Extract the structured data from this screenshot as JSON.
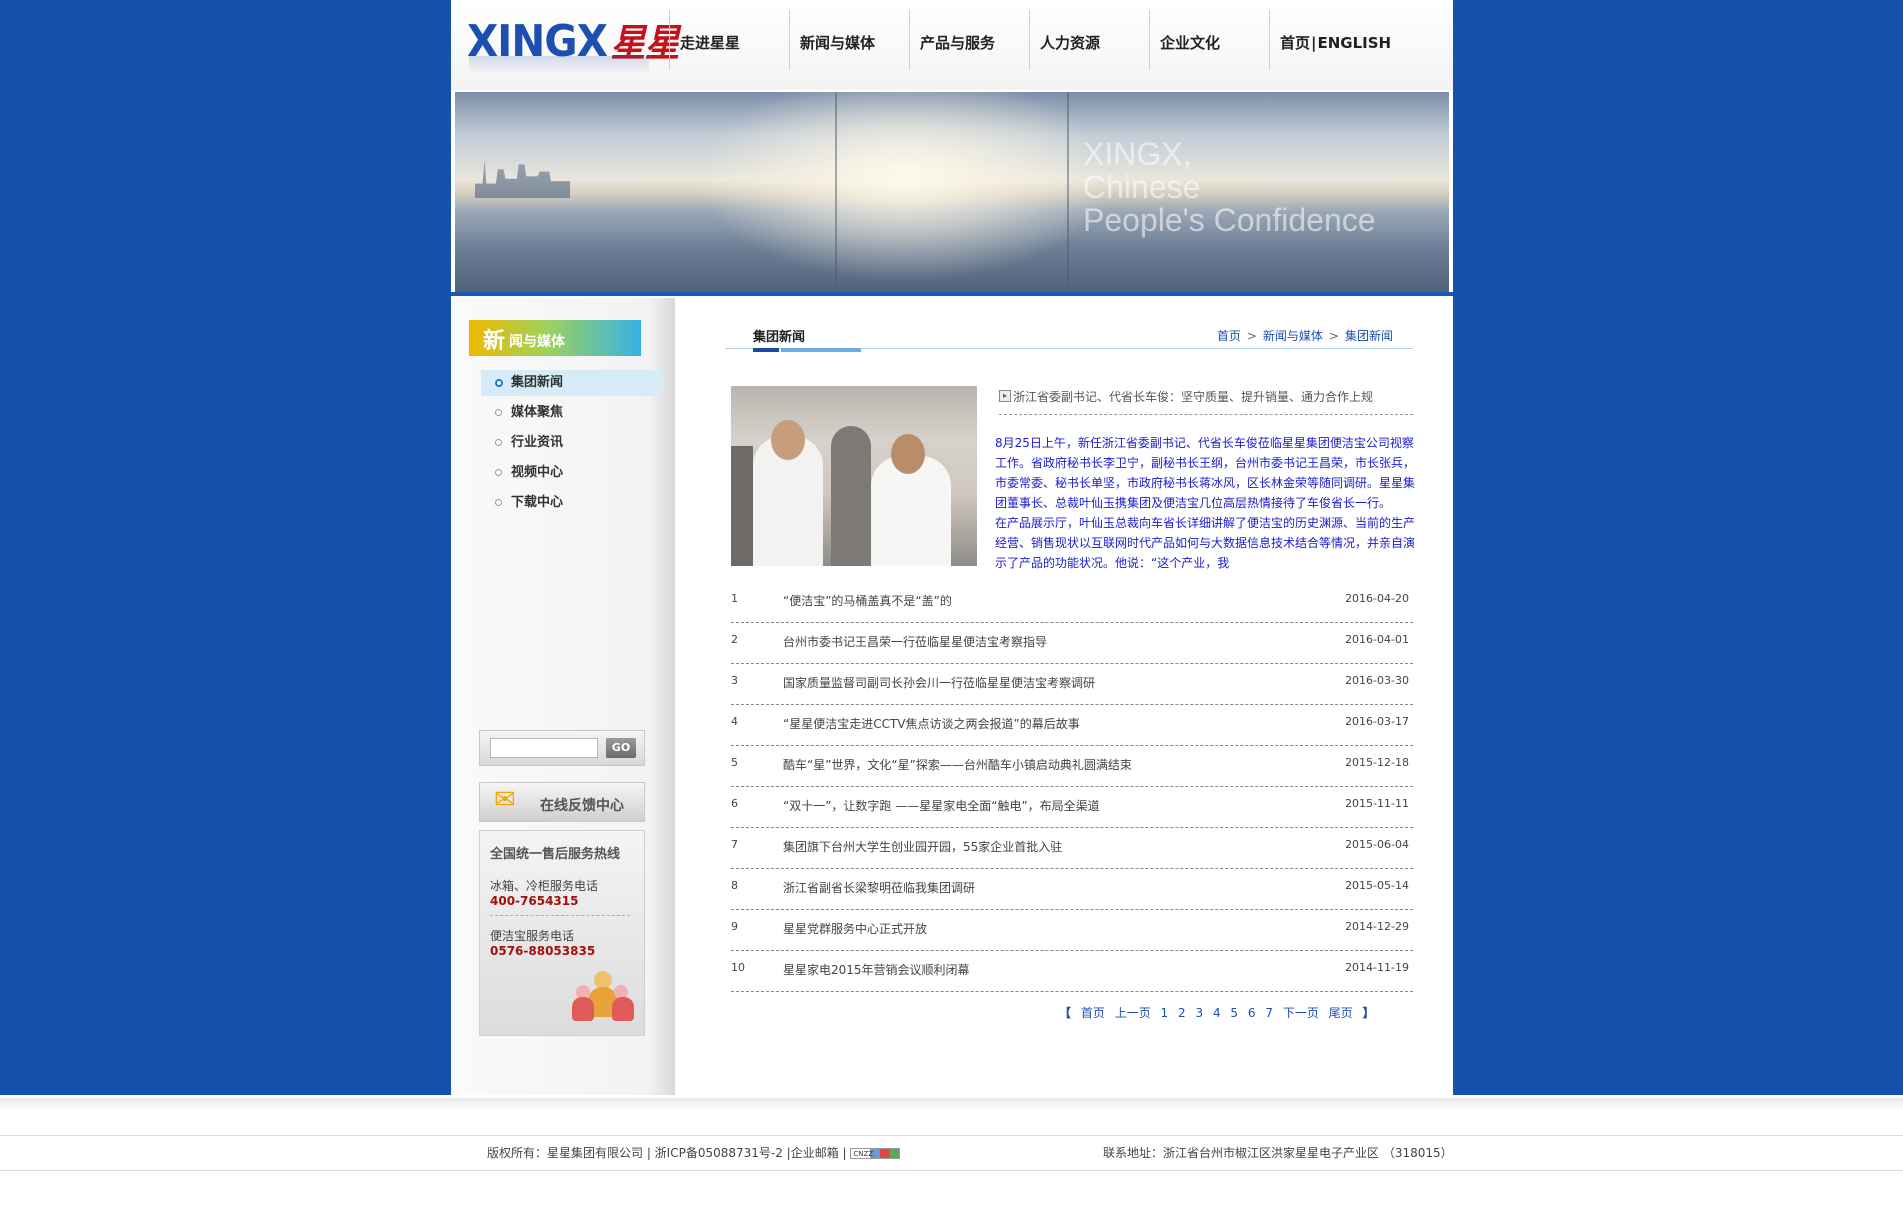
{
  "header": {
    "logo_text": "XINGX",
    "logo_cn": "星星",
    "nav": [
      "走进星星",
      "新闻与媒体",
      "产品与服务",
      "人力资源",
      "企业文化"
    ],
    "nav_home": "首页",
    "nav_english": "ENGLISH"
  },
  "banner": {
    "line1": "XINGX,",
    "line2": "Chinese",
    "line3": "People's Confidence"
  },
  "sidebar": {
    "title_big": "新",
    "title_rest": "闻与媒体",
    "menu": [
      "集团新闻",
      "媒体聚焦",
      "行业资讯",
      "视频中心",
      "下载中心"
    ],
    "search_placeholder": "",
    "search_button": "GO",
    "feedback_label": "在线反馈中心",
    "service_title": "全国统一售后服务热线",
    "service1_label": "冰箱、冷柜服务电话",
    "service1_phone": "400-7654315",
    "service2_label": "便洁宝服务电话",
    "service2_phone": "0576-88053835"
  },
  "content": {
    "section_title": "集团新闻",
    "breadcrumb": [
      "首页",
      "新闻与媒体",
      "集团新闻"
    ],
    "feature_title": "浙江省委副书记、代省长车俊：坚守质量、提升销量、通力合作上规",
    "feature_body": "8月25日上午，新任浙江省委副书记、代省长车俊莅临星星集团便洁宝公司视察工作。省政府秘书长李卫宁，副秘书长王纲，台州市委书记王昌荣，市长张兵，市委常委、秘书长单坚，市政府秘书长蒋冰风，区长林金荣等随同调研。星星集团董事长、总裁叶仙玉携集团及便洁宝几位高层热情接待了车俊省长一行。　　在产品展示厅，叶仙玉总裁向车省长详细讲解了便洁宝的历史渊源、当前的生产经营、销售现状以互联网时代产品如何与大数据信息技术结合等情况，并亲自演示了产品的功能状况。他说：“这个产业，我",
    "news": [
      {
        "num": "1",
        "title": "“便洁宝”的马桶盖真不是“盖”的",
        "date": "2016-04-20"
      },
      {
        "num": "2",
        "title": "台州市委书记王昌荣一行莅临星星便洁宝考察指导",
        "date": "2016-04-01"
      },
      {
        "num": "3",
        "title": "国家质量监督司副司长孙会川一行莅临星星便洁宝考察调研",
        "date": "2016-03-30"
      },
      {
        "num": "4",
        "title": "“星星便洁宝走进CCTV焦点访谈之两会报道”的幕后故事",
        "date": "2016-03-17"
      },
      {
        "num": "5",
        "title": "酷车“星”世界，文化“星”探索——台州酷车小镇启动典礼圆满结束",
        "date": "2015-12-18"
      },
      {
        "num": "6",
        "title": "“双十一”，让数字跑 ——星星家电全面“触电”，布局全渠道",
        "date": "2015-11-11"
      },
      {
        "num": "7",
        "title": "集团旗下台州大学生创业园开园，55家企业首批入驻",
        "date": "2015-06-04"
      },
      {
        "num": "8",
        "title": "浙江省副省长梁黎明莅临我集团调研",
        "date": "2015-05-14"
      },
      {
        "num": "9",
        "title": "星星党群服务中心正式开放",
        "date": "2014-12-29"
      },
      {
        "num": "10",
        "title": " 星星家电2015年营销会议顺利闭幕",
        "date": "2014-11-19"
      }
    ],
    "pager": {
      "open": "【",
      "first": "首页",
      "prev": "上一页",
      "pages": [
        "1",
        "2",
        "3",
        "4",
        "5",
        "6",
        "7"
      ],
      "next": "下一页",
      "last": "尾页",
      "close": "】"
    }
  },
  "footer": {
    "copyright": "版权所有：星星集团有限公司 | 浙ICP备05088731号-2 |企业邮箱 |",
    "cnzz": "CNZZ",
    "address": "联系地址：浙江省台州市椒江区洪家星星电子产业区 （318015）"
  }
}
